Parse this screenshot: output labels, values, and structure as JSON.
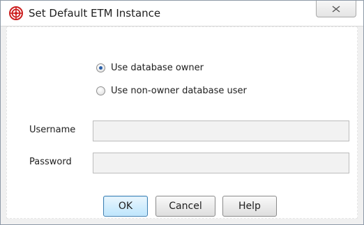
{
  "window": {
    "title": "Set Default ETM Instance",
    "icon": "red-target-icon",
    "close_icon": "close-icon"
  },
  "options": {
    "use_owner_label": "Use database owner",
    "use_owner_selected": true,
    "use_non_owner_label": "Use non-owner database user",
    "use_non_owner_selected": false
  },
  "fields": {
    "username_label": "Username",
    "username_value": "",
    "password_label": "Password",
    "password_value": ""
  },
  "buttons": {
    "ok_label": "OK",
    "cancel_label": "Cancel",
    "help_label": "Help"
  },
  "colors": {
    "accent": "#cc1f1f",
    "radio_dot": "#2a5fa8"
  }
}
